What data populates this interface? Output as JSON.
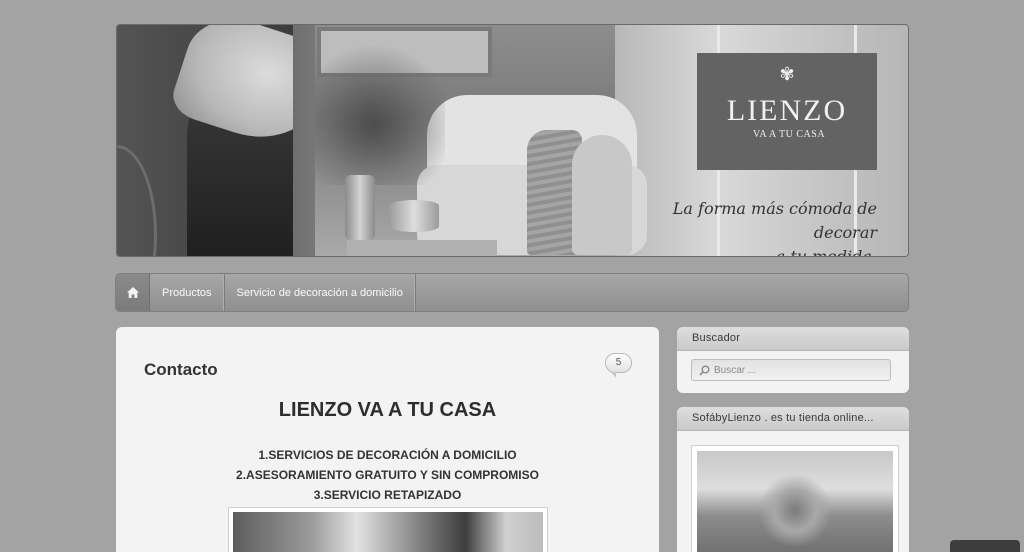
{
  "banner": {
    "logo_title": "LIENZO",
    "logo_subtitle": "VA A TU CASA",
    "tagline_line1": "La forma más cómoda de decorar",
    "tagline_line2": "a tu medida."
  },
  "nav": {
    "home_icon": "home-icon",
    "items": [
      {
        "label": "Productos"
      },
      {
        "label": "Servicio de decoración a domicilio"
      }
    ]
  },
  "content": {
    "page_title": "Contacto",
    "comment_count": "5",
    "heading": "LIENZO VA A TU CASA",
    "services": [
      "1.SERVICIOS DE DECORACIÓN A DOMICILIO",
      "2.ASESORAMIENTO GRATUITO Y SIN COMPROMISO",
      "3.SERVICIO RETAPIZADO"
    ]
  },
  "sidebar": {
    "search": {
      "title": "Buscador",
      "placeholder": "Buscar ...",
      "icon": "search-icon"
    },
    "shop": {
      "title": "SofábyLienzo . es tu tienda online..."
    }
  },
  "colors": {
    "page_background": "#a3a3a3",
    "card_background": "#f3f3f3",
    "logo_box": "#636363"
  }
}
